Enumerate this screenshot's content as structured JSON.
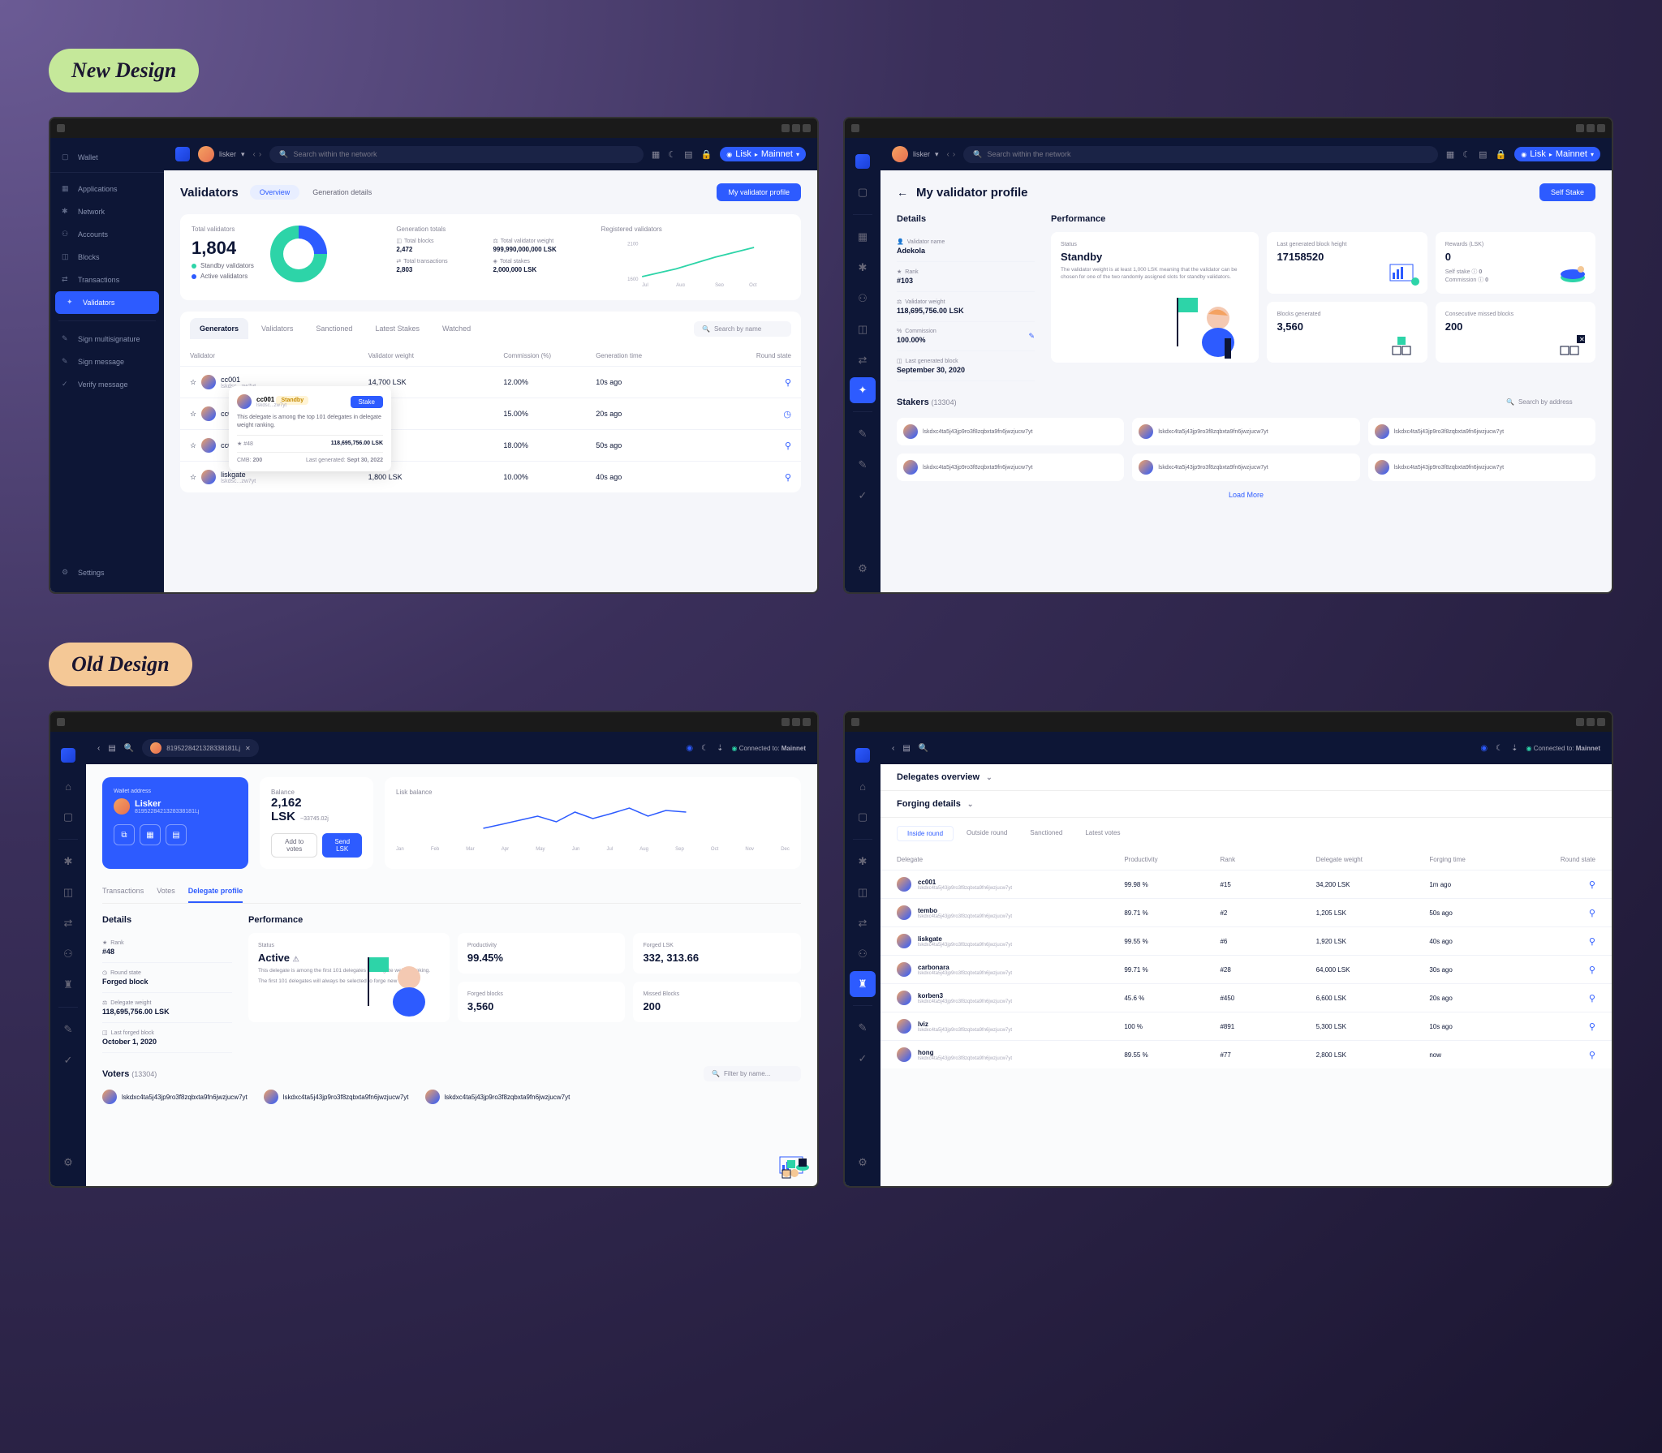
{
  "labels": {
    "new": "New Design",
    "old": "Old Design"
  },
  "topbar": {
    "username": "lisker",
    "search_placeholder": "Search within the network",
    "network": "Lisk",
    "network_env": "Mainnet"
  },
  "sidebar": {
    "wallet": "Wallet",
    "applications": "Applications",
    "network": "Network",
    "accounts": "Accounts",
    "blocks": "Blocks",
    "transactions": "Transactions",
    "validators": "Validators",
    "sign_multisig": "Sign multisignature",
    "sign_message": "Sign message",
    "verify_message": "Verify message",
    "settings": "Settings"
  },
  "validators": {
    "title": "Validators",
    "tab_overview": "Overview",
    "tab_generation": "Generation details",
    "btn_profile": "My validator profile",
    "total_label": "Total validators",
    "total_value": "1,804",
    "legend_standby": "Standby validators",
    "legend_active": "Active validators",
    "gen_totals_label": "Generation totals",
    "gen": {
      "total_blocks_label": "Total blocks",
      "total_blocks": "2,472",
      "total_weight_label": "Total validator weight",
      "total_weight": "999,990,000,000 LSK",
      "total_tx_label": "Total transactions",
      "total_tx": "2,803",
      "total_stakes_label": "Total stakes",
      "total_stakes": "2,000,000 LSK"
    },
    "registered_label": "Registered validators",
    "chart_months": [
      "Jul",
      "Aug",
      "Sep",
      "Oct"
    ],
    "subtabs": {
      "generators": "Generators",
      "validators": "Validators",
      "sanctioned": "Sanctioned",
      "latest_stakes": "Latest Stakes",
      "watched": "Watched"
    },
    "search_placeholder": "Search by name",
    "columns": {
      "validator": "Validator",
      "weight": "Validator weight",
      "commission": "Commission (%)",
      "gentime": "Generation time",
      "state": "Round state"
    },
    "rows": [
      {
        "name": "cc001",
        "addr": "lskdsc...zw7yt",
        "weight": "14,700 LSK",
        "commission": "12.00%",
        "gentime": "10s ago"
      },
      {
        "name": "cc001",
        "addr": "lskdsc...zw7yt",
        "weight": "—",
        "commission": "15.00%",
        "gentime": "20s ago"
      },
      {
        "name": "cc001",
        "addr": "lskdsc...zw7yt",
        "weight": "—",
        "commission": "18.00%",
        "gentime": "50s ago"
      },
      {
        "name": "liskgate",
        "addr": "lskdsc...zw7yt",
        "weight": "1,800 LSK",
        "commission": "10.00%",
        "gentime": "40s ago"
      }
    ],
    "tooltip": {
      "name": "cc001",
      "addr": "lskdsc...zw7yt",
      "badge": "Standby",
      "btn": "Stake",
      "desc": "This delegate is among the top 101 delegates in delegate weight ranking.",
      "rank_label": "#48",
      "weight": "118,695,756.00 LSK",
      "cmb_label": "CMB:",
      "cmb": "200",
      "lastgen_label": "Last generated:",
      "lastgen": "Sept 30, 2022"
    }
  },
  "profile": {
    "title": "My validator profile",
    "btn_self_stake": "Self Stake",
    "details_title": "Details",
    "performance_title": "Performance",
    "details": {
      "name_label": "Validator name",
      "name": "Adekola",
      "rank_label": "Rank",
      "rank": "#103",
      "weight_label": "Validator weight",
      "weight": "118,695,756.00 LSK",
      "commission_label": "Commission",
      "commission": "100.00%",
      "lastgen_label": "Last generated block",
      "lastgen": "September 30, 2020"
    },
    "perf": {
      "status_label": "Status",
      "status": "Standby",
      "status_desc": "The validator weight is at least 1,000 LSK meaning that the validator can be chosen for one of the two randomly assigned slots for standby validators.",
      "height_label": "Last generated block height",
      "height": "17158520",
      "rewards_label": "Rewards (LSK)",
      "rewards": "0",
      "selfstake_label": "Self stake",
      "selfstake": "0",
      "commission_label": "Commission",
      "commission": "0",
      "blocks_label": "Blocks generated",
      "blocks": "3,560",
      "missed_label": "Consecutive missed blocks",
      "missed": "200"
    },
    "stakers_label": "Stakers",
    "stakers_count": "(13304)",
    "search_placeholder": "Search by address",
    "staker_addr": "lskdxc4ta5j43jp9ro3f8zqbxta9fn6jwzjucw7yt",
    "load_more": "Load More"
  },
  "old_profile": {
    "search_value": "8195228421328338181Lj",
    "connected": "Connected to:",
    "mainnet": "Mainnet",
    "wallet_address_label": "Wallet address",
    "name": "Lisker",
    "addr": "8195228421328338181Lj",
    "balance_label": "Balance",
    "balance": "2,162 LSK",
    "balance_change": "~33745.02j",
    "btn_add_votes": "Add to votes",
    "btn_send": "Send LSK",
    "chart_label": "Lisk balance",
    "chart_months": [
      "Jan",
      "Feb",
      "Mar",
      "Apr",
      "May",
      "Jun",
      "Jul",
      "Aug",
      "Sep",
      "Oct",
      "Nov",
      "Dec"
    ],
    "tabs": {
      "transactions": "Transactions",
      "votes": "Votes",
      "delegate": "Delegate profile"
    },
    "details_title": "Details",
    "performance_title": "Performance",
    "details": {
      "rank_label": "Rank",
      "rank": "#48",
      "roundstate_label": "Round state",
      "roundstate": "Forged block",
      "weight_label": "Delegate weight",
      "weight": "118,695,756.00 LSK",
      "lastforged_label": "Last forged block",
      "lastforged": "October 1, 2020"
    },
    "perf": {
      "status_label": "Status",
      "status": "Active",
      "status_desc": "This delegate is among the first 101 delegates in delegate weight ranking.",
      "status_desc2": "The first 101 delegates will always be selected to forge new blocks.",
      "prod_label": "Productivity",
      "prod": "99.45%",
      "forged_lsk_label": "Forged LSK",
      "forged_lsk": "332, 313.66",
      "forged_blocks_label": "Forged blocks",
      "forged_blocks": "3,560",
      "missed_label": "Missed Blocks",
      "missed": "200"
    },
    "voters_label": "Voters",
    "voters_count": "(13304)",
    "filter_placeholder": "Filter by name...",
    "voter_addr": "lskdxc4ta5j43jp9ro3f8zqbxta9fn6jwzjucw7yt"
  },
  "delegates": {
    "connected": "Connected to:",
    "mainnet": "Mainnet",
    "overview_title": "Delegates overview",
    "forging_title": "Forging details",
    "pill_tabs": {
      "inside": "Inside round",
      "outside": "Outside round",
      "sanctioned": "Sanctioned",
      "latest": "Latest votes"
    },
    "columns": {
      "delegate": "Delegate",
      "productivity": "Productivity",
      "rank": "Rank",
      "weight": "Delegate weight",
      "forging": "Forging time",
      "state": "Round state"
    },
    "rows": [
      {
        "name": "cc001",
        "prod": "99.98 %",
        "rank": "#15",
        "weight": "34,200 LSK",
        "forging": "1m ago"
      },
      {
        "name": "tembo",
        "prod": "89.71 %",
        "rank": "#2",
        "weight": "1,205 LSK",
        "forging": "50s ago"
      },
      {
        "name": "liskgate",
        "prod": "99.55 %",
        "rank": "#6",
        "weight": "1,920 LSK",
        "forging": "40s ago"
      },
      {
        "name": "carbonara",
        "prod": "99.71 %",
        "rank": "#28",
        "weight": "64,000 LSK",
        "forging": "30s ago"
      },
      {
        "name": "korben3",
        "prod": "45.6 %",
        "rank": "#450",
        "weight": "6,600 LSK",
        "forging": "20s ago"
      },
      {
        "name": "lviz",
        "prod": "100 %",
        "rank": "#891",
        "weight": "5,300 LSK",
        "forging": "10s ago"
      },
      {
        "name": "hong",
        "prod": "89.55 %",
        "rank": "#77",
        "weight": "2,800 LSK",
        "forging": "now"
      }
    ],
    "row_addr": "lskdxc4ta5j43jp9ro3f8zqbxta9fn6jwzjucw7yt"
  },
  "chart_data": [
    {
      "type": "line",
      "title": "Registered validators",
      "x": [
        "Jul",
        "Aug",
        "Sep",
        "Oct"
      ],
      "y": [
        1650,
        1720,
        1780,
        1810
      ],
      "ylim": [
        1600,
        2100
      ]
    },
    {
      "type": "line",
      "title": "Lisk balance",
      "x": [
        "Jan",
        "Feb",
        "Mar",
        "Apr",
        "May",
        "Jun",
        "Jul",
        "Aug",
        "Sep",
        "Oct",
        "Nov",
        "Dec"
      ],
      "y": [
        1800,
        1850,
        1900,
        2000,
        1950,
        2050,
        2100,
        2080,
        2120,
        2160,
        2140,
        2162
      ]
    }
  ]
}
